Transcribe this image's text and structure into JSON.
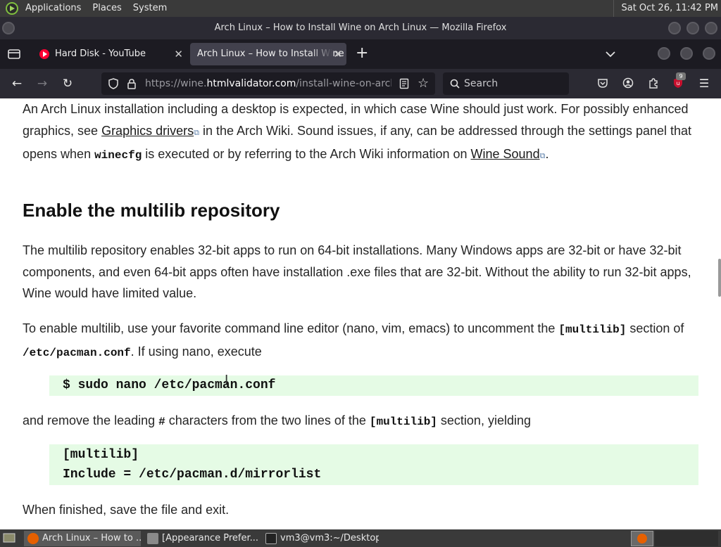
{
  "top_panel": {
    "menus": [
      "Applications",
      "Places",
      "System"
    ],
    "clock": "Sat Oct 26, 11:42 PM"
  },
  "window": {
    "title": "Arch Linux – How to Install Wine on Arch Linux — Mozilla Firefox"
  },
  "tabs": [
    {
      "label": "Hard Disk - YouTube",
      "icon": "youtube-icon"
    },
    {
      "label": "Arch Linux – How to Install Wine on Arch Linux",
      "icon": "none"
    }
  ],
  "nav": {
    "url_prefix": "https://wine.",
    "url_domain": "htmlvalidator.com",
    "url_path": "/install-wine-on-arch-linux.html",
    "search_placeholder": "Search",
    "extension_badge": "9"
  },
  "page": {
    "p1_a": "An Arch Linux installation including a desktop is expected, in which case Wine should just work. For possibly enhanced graphics, see ",
    "link_graphics": "Graphics drivers",
    "p1_b": " in the Arch Wiki. Sound issues, if any, can be addressed through the settings panel that opens when ",
    "code_winecfg": "winecfg",
    "p1_c": " is executed or by referring to the Arch Wiki information on ",
    "link_sound": "Wine Sound",
    "p1_d": ".",
    "heading": "Enable the multilib repository",
    "p2": "The multilib repository enables 32-bit apps to run on 64-bit installations. Many Windows apps are 32-bit or have 32-bit components, and even 64-bit apps often have installation .exe files that are 32-bit. Without the ability to run 32-bit apps, Wine would have limited value.",
    "p3_a": "To enable multilib, use your favorite command line editor (nano, vim, emacs) to uncomment the ",
    "code_multilib": "[multilib]",
    "p3_b": " section of ",
    "code_pacman": "/etc/pacman.conf",
    "p3_c": ". If using nano, execute",
    "code_block_1": "$ sudo nano /etc/pacman.conf",
    "p4_a": "and remove the leading ",
    "code_hash": "#",
    "p4_b": " characters from the two lines of the ",
    "code_multilib2": "[multilib]",
    "p4_c": " section, yielding",
    "code_block_2_line1": "[multilib]",
    "code_block_2_line2": "Include = /etc/pacman.d/mirrorlist",
    "p5": "When finished, save the file and exit."
  },
  "taskbar": {
    "items": [
      {
        "label": "Arch Linux – How to ..."
      },
      {
        "label": "[Appearance Prefer..."
      },
      {
        "label": "vm3@vm3:~/Desktop"
      }
    ]
  },
  "colors": {
    "code_bg": "#e5fbe5",
    "chrome_dark": "#2b2a33",
    "tab_active": "#42414d"
  }
}
